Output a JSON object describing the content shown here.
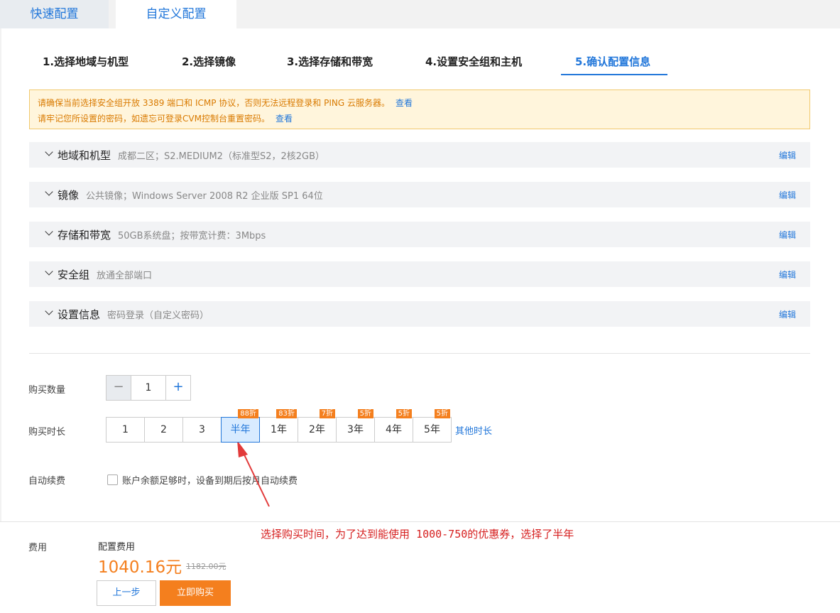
{
  "tabs": {
    "quick": "快速配置",
    "custom": "自定义配置"
  },
  "steps": [
    {
      "label": "1.选择地域与机型"
    },
    {
      "label": "2.选择镜像"
    },
    {
      "label": "3.选择存储和带宽"
    },
    {
      "label": "4.设置安全组和主机"
    },
    {
      "label": "5.确认配置信息"
    }
  ],
  "notice": {
    "line1": "请确保当前选择安全组开放 3389 端口和 ICMP 协议，否则无法远程登录和 PING 云服务器。",
    "line2": "请牢记您所设置的密码，如遗忘可登录CVM控制台重置密码。",
    "link": "查看"
  },
  "sections": [
    {
      "title": "地域和机型",
      "summary": "成都二区；S2.MEDIUM2（标准型S2，2核2GB）",
      "edit": "编辑"
    },
    {
      "title": "镜像",
      "summary": "公共镜像；Windows Server 2008 R2 企业版 SP1 64位",
      "edit": "编辑"
    },
    {
      "title": "存储和带宽",
      "summary": "50GB系统盘；按带宽计费：3Mbps",
      "edit": "编辑"
    },
    {
      "title": "安全组",
      "summary": "放通全部端口",
      "edit": "编辑"
    },
    {
      "title": "设置信息",
      "summary": "密码登录（自定义密码）",
      "edit": "编辑"
    }
  ],
  "quantity": {
    "label": "购买数量",
    "minus": "−",
    "value": "1",
    "plus": "+"
  },
  "duration": {
    "label": "购买时长",
    "options": [
      {
        "label": "1",
        "discount": ""
      },
      {
        "label": "2",
        "discount": ""
      },
      {
        "label": "3",
        "discount": ""
      },
      {
        "label": "半年",
        "discount": "88折"
      },
      {
        "label": "1年",
        "discount": "83折"
      },
      {
        "label": "2年",
        "discount": "7折"
      },
      {
        "label": "3年",
        "discount": "5折"
      },
      {
        "label": "4年",
        "discount": "5折"
      },
      {
        "label": "5年",
        "discount": "5折"
      }
    ],
    "selected": "半年",
    "other": "其他时长"
  },
  "autorenew": {
    "label": "自动续费",
    "checkbox_text": "账户余额足够时，设备到期后按月自动续费"
  },
  "footer": {
    "fee_label": "费用",
    "config_fee_label": "配置费用",
    "price": "1040.16元",
    "original_price": "1182.00元",
    "prev": "上一步",
    "buy": "立即购买"
  },
  "annotation": "选择购买时间，为了达到能使用 1000-750的优惠券，选择了半年",
  "colors": {
    "accent": "#2277da",
    "orange": "#f47f1e",
    "annotation": "#d62020"
  }
}
